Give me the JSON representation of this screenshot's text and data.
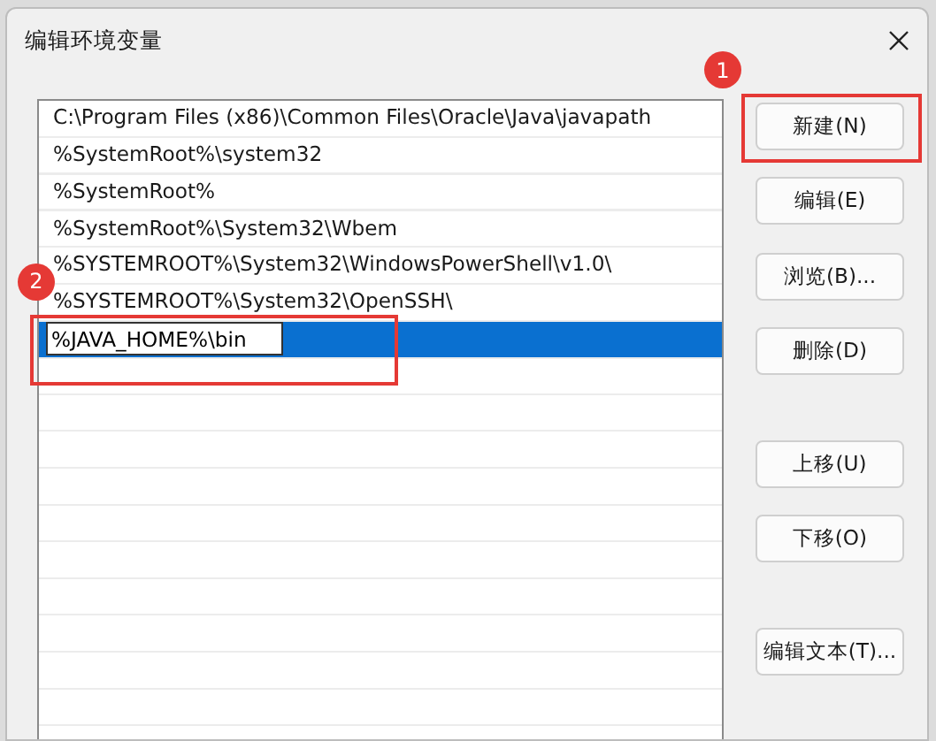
{
  "window": {
    "title": "编辑环境变量"
  },
  "paths": [
    {
      "kind": "text",
      "text": "C:\\Program Files (x86)\\Common Files\\Oracle\\Java\\javapath",
      "selected": false
    },
    {
      "kind": "text",
      "text": "%SystemRoot%\\system32",
      "selected": false
    },
    {
      "kind": "text",
      "text": "%SystemRoot%",
      "selected": false
    },
    {
      "kind": "text",
      "text": "%SystemRoot%\\System32\\Wbem",
      "selected": false
    },
    {
      "kind": "text",
      "text": "%SYSTEMROOT%\\System32\\WindowsPowerShell\\v1.0\\",
      "selected": false
    },
    {
      "kind": "text",
      "text": "%SYSTEMROOT%\\System32\\OpenSSH\\",
      "selected": false
    },
    {
      "kind": "edit",
      "text": "%JAVA_HOME%\\bin",
      "selected": true
    }
  ],
  "buttons": [
    {
      "label": "新建(N)",
      "highlighted": true,
      "callout": "1"
    },
    {
      "label": "编辑(E)",
      "highlighted": false
    },
    {
      "label": "浏览(B)...",
      "highlighted": false
    },
    {
      "label": "删除(D)",
      "highlighted": false
    },
    {
      "label": "上移(U)",
      "highlighted": false
    },
    {
      "label": "下移(O)",
      "highlighted": false
    },
    {
      "label": "编辑文本(T)...",
      "highlighted": false
    }
  ],
  "edit_callout": "2"
}
